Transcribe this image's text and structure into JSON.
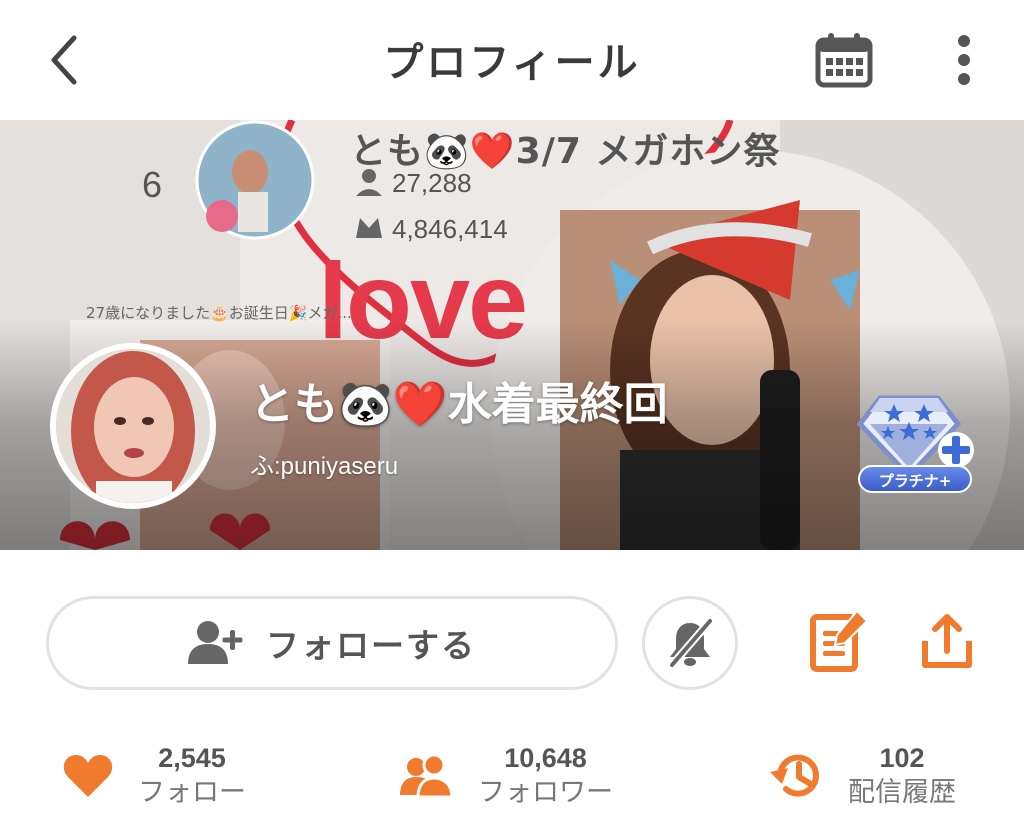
{
  "header": {
    "title": "プロフィール",
    "back_icon": "chevron-left-icon",
    "calendar_icon": "calendar-icon",
    "more_icon": "more-vertical-icon"
  },
  "banner": {
    "background_card": {
      "rank": "6",
      "name": "とも🐼❤️3/7 メガホン祭",
      "stat1": "27,288",
      "stat2": "4,846,414",
      "love_text": "love",
      "caption": "27歳になりました🎂お誕生日🎉メガ..."
    },
    "profile": {
      "display_name": "とも🐼❤️水着最終回",
      "handle": "ふ:puniyaseru"
    },
    "rank_badge": {
      "label": "プラチナ+"
    }
  },
  "actions": {
    "follow_label": "フォローする",
    "follow_icon": "user-plus-icon",
    "notify_icon": "bell-off-icon",
    "letter_icon": "letter-edit-icon",
    "share_icon": "share-icon"
  },
  "stats": [
    {
      "value": "2,545",
      "label": "フォロー",
      "icon": "heart-icon"
    },
    {
      "value": "10,648",
      "label": "フォロワー",
      "icon": "users-icon"
    },
    {
      "value": "102",
      "label": "配信履歴",
      "icon": "history-icon"
    }
  ],
  "colors": {
    "accent": "#f07a2e",
    "love_red": "#e53a4b",
    "badge_blue": "#4a6fd8"
  }
}
